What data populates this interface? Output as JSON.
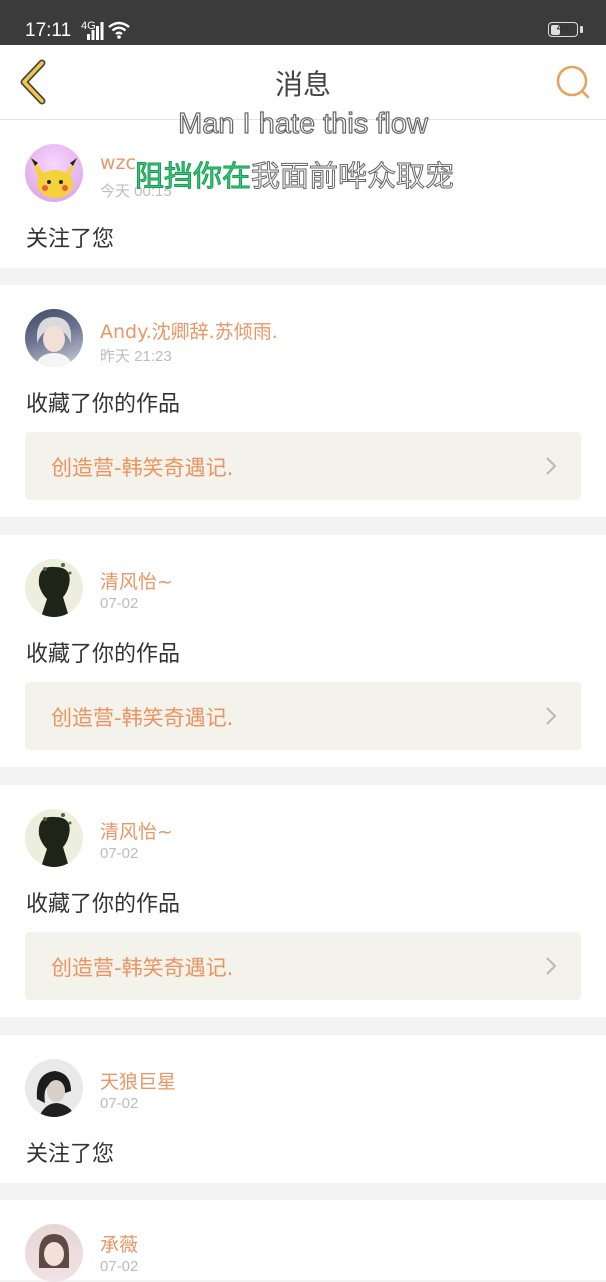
{
  "status_bar": {
    "time": "17:11",
    "network": "4G",
    "battery": "46",
    "battery_percent": 46
  },
  "header": {
    "title": "消息",
    "back_icon": "chevron-left-icon",
    "search_icon": "search-icon",
    "accent_color": "#e9a35c"
  },
  "overlay": {
    "english": "Man I hate this flow",
    "chinese_highlighted": "阻挡你在",
    "chinese_rest": "我面前哗众取宠"
  },
  "messages": [
    {
      "username": "wzc",
      "time": "今天 00:15",
      "action": "关注了您"
    },
    {
      "username": "Andy.沈卿辞.苏倾雨.",
      "time": "昨天 21:23",
      "action": "收藏了你的作品",
      "work": "创造营-韩笑奇遇记."
    },
    {
      "username": "清风怡~",
      "time": "07-02",
      "action": "收藏了你的作品",
      "work": "创造营-韩笑奇遇记."
    },
    {
      "username": "清风怡~",
      "time": "07-02",
      "action": "收藏了你的作品",
      "work": "创造营-韩笑奇遇记."
    },
    {
      "username": "天狼巨星",
      "time": "07-02",
      "action": "关注了您"
    },
    {
      "username": "承薇",
      "time": "07-02"
    }
  ],
  "colors": {
    "username": "#e99766",
    "work_title": "#ec9362",
    "work_bg": "#f3f3ec"
  }
}
